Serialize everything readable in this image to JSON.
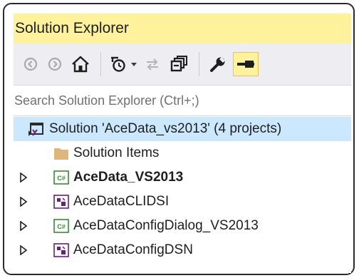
{
  "panel": {
    "title": "Solution Explorer"
  },
  "toolbar": {
    "buttons": [
      {
        "icon": "back-arrow-icon"
      },
      {
        "icon": "forward-arrow-icon"
      },
      {
        "icon": "home-icon"
      },
      {
        "icon": "pending-changes-filter-icon"
      },
      {
        "icon": "dropdown-arrow-icon"
      },
      {
        "icon": "sync-with-document-icon"
      },
      {
        "icon": "collapse-all-icon"
      },
      {
        "icon": "properties-wrench-icon"
      },
      {
        "icon": "auto-hide-pin-icon"
      }
    ]
  },
  "search": {
    "placeholder": "Search Solution Explorer (Ctrl+;)"
  },
  "tree": {
    "solution": {
      "label": "Solution 'AceData_vs2013' (4 projects)",
      "icon": "solution-icon"
    },
    "items": [
      {
        "label": "Solution Items",
        "icon": "folder-icon",
        "bold": false
      },
      {
        "label": "AceData_VS2013",
        "icon": "csharp-project-icon",
        "bold": true
      },
      {
        "label": "AceDataCLIDSI",
        "icon": "cpp-project-icon",
        "bold": false
      },
      {
        "label": "AceDataConfigDialog_VS2013",
        "icon": "csharp-project-icon",
        "bold": false
      },
      {
        "label": "AceDataConfigDSN",
        "icon": "cpp-project-icon",
        "bold": false
      }
    ]
  },
  "colors": {
    "title_bar": "#fff29d",
    "selection": "#cce8ff",
    "background": "#eeeef2",
    "csharp_green": "#388a34",
    "cpp_purple": "#68217a"
  }
}
